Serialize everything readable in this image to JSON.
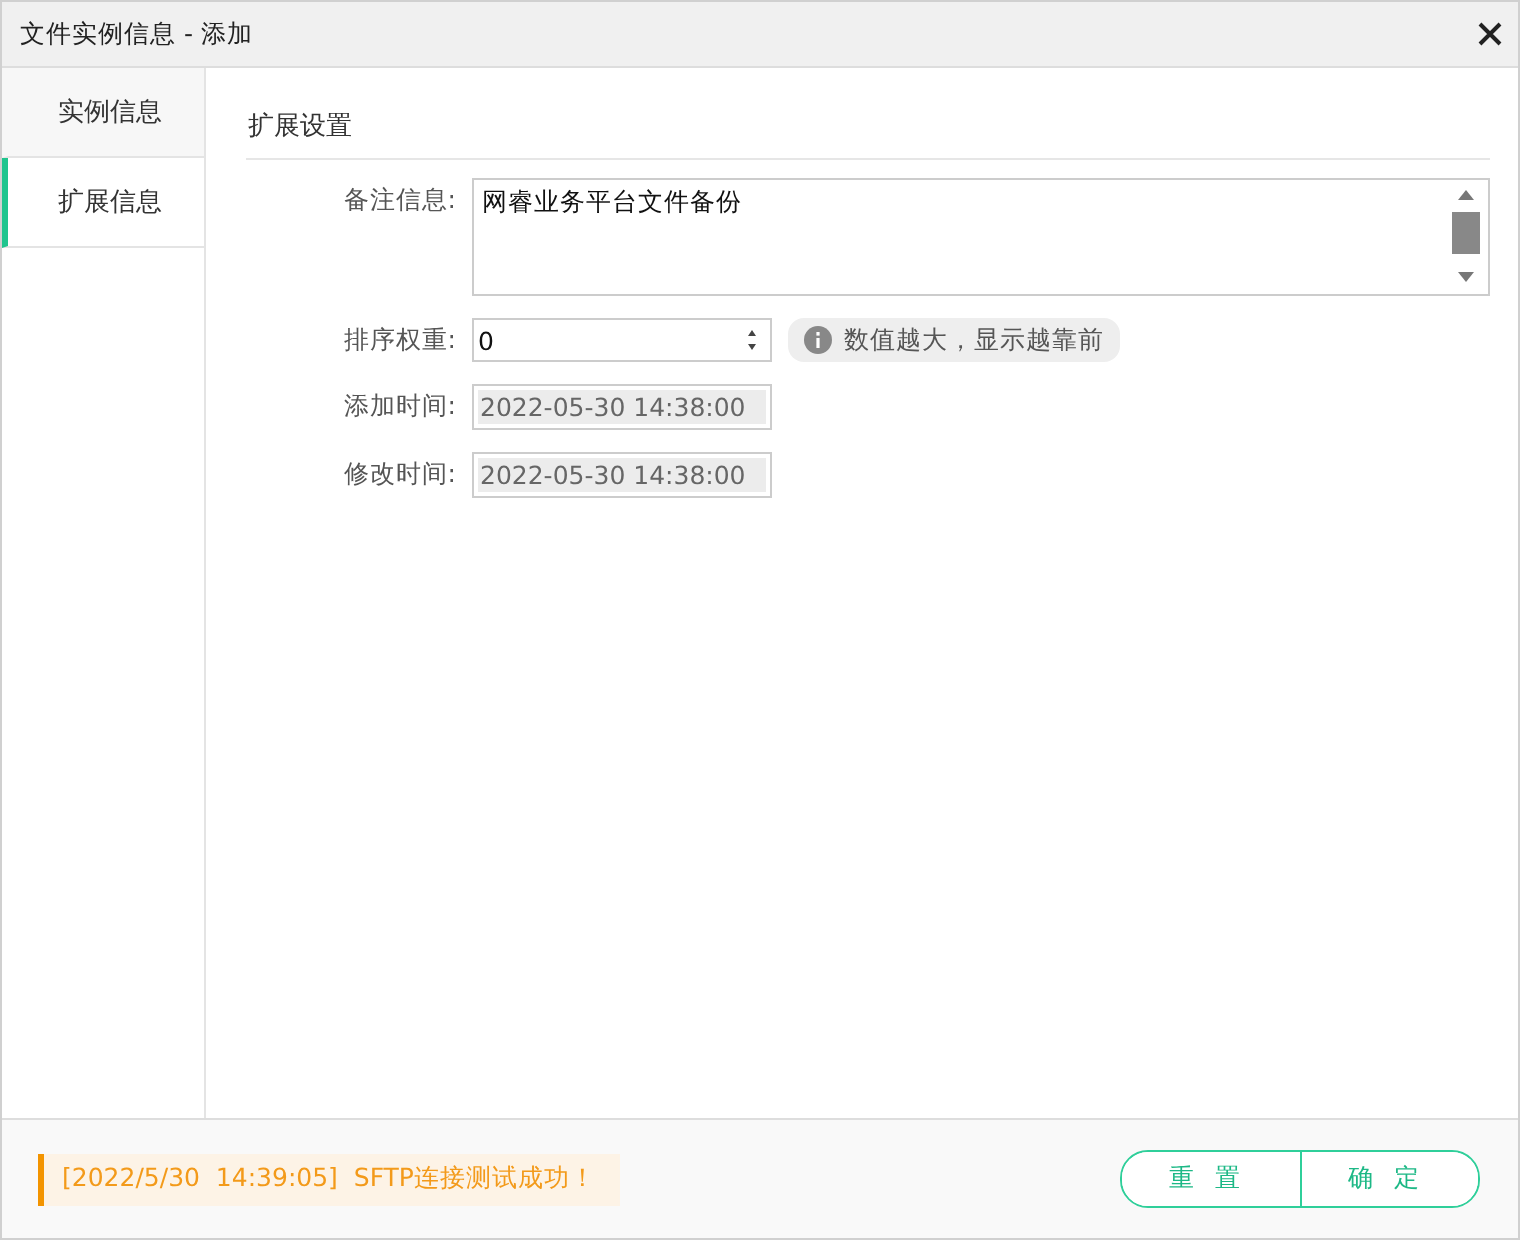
{
  "window": {
    "title": "文件实例信息 - 添加"
  },
  "tabs": [
    {
      "label": "实例信息",
      "selected": false
    },
    {
      "label": "扩展信息",
      "selected": true
    }
  ],
  "section": {
    "title": "扩展设置"
  },
  "fields": [
    {
      "kind": "textarea",
      "label": "备注信息:",
      "value": "网睿业务平台文件备份",
      "disabled": false
    },
    {
      "kind": "number",
      "label": "排序权重:",
      "value": "0",
      "disabled": false,
      "hint": "数值越大，显示越靠前"
    },
    {
      "kind": "text",
      "label": "添加时间:",
      "value": "2022-05-30 14:38:00",
      "disabled": true
    },
    {
      "kind": "text",
      "label": "修改时间:",
      "value": "2022-05-30 14:38:00",
      "disabled": true
    }
  ],
  "status_message": "[2022/5/30  14:39:05]  SFTP连接测试成功！",
  "buttons": [
    "重置",
    "确定"
  ]
}
